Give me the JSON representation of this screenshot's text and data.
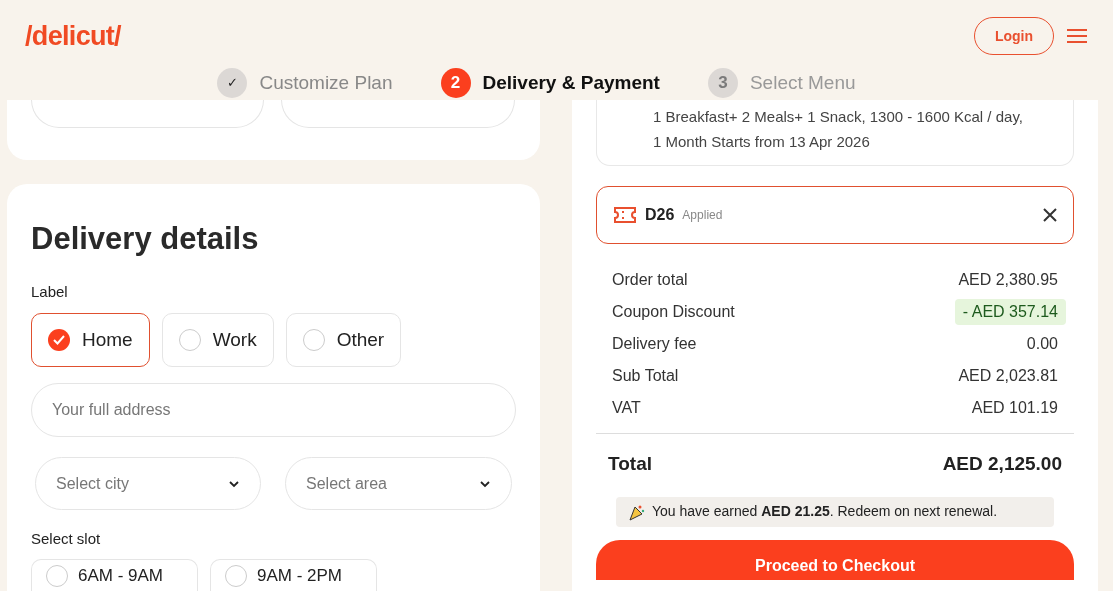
{
  "header": {
    "logo": "/delicut/",
    "login": "Login"
  },
  "steps": [
    {
      "number": "✓",
      "label": "Customize Plan",
      "selected": false,
      "completed": true
    },
    {
      "number": "2",
      "label": "Delivery & Payment",
      "selected": true,
      "completed": false
    },
    {
      "number": "3",
      "label": "Select Menu",
      "selected": false,
      "completed": false
    }
  ],
  "delivery": {
    "title": "Delivery details",
    "label_heading": "Label",
    "labels": [
      {
        "text": "Home",
        "selected": true
      },
      {
        "text": "Work",
        "selected": false
      },
      {
        "text": "Other",
        "selected": false
      }
    ],
    "address": {
      "placeholder": "Your full address"
    },
    "city": {
      "placeholder": "Select city"
    },
    "area": {
      "placeholder": "Select area"
    },
    "slot_heading": "Select slot",
    "slots": [
      {
        "text": "6AM - 9AM",
        "selected": false
      },
      {
        "text": "9AM - 2PM",
        "selected": false
      }
    ]
  },
  "plan": {
    "lines": [
      "1 Breakfast+ 2 Meals+ 1 Snack, 1300 - 1600 Kcal / day,",
      "1 Month Starts from 13 Apr 2026"
    ]
  },
  "coupon": {
    "code": "D26",
    "status": "Applied"
  },
  "summary": [
    {
      "label": "Order total",
      "value": "AED 2,380.95",
      "kind": "plain"
    },
    {
      "label": "Coupon Discount",
      "value": "- AED 357.14",
      "kind": "discount"
    },
    {
      "label": "Delivery fee",
      "value": "0.00",
      "kind": "plain"
    },
    {
      "label": "Sub Total",
      "value": "AED 2,023.81",
      "kind": "plain"
    },
    {
      "label": "VAT",
      "value": "AED 101.19",
      "kind": "plain"
    }
  ],
  "total": {
    "label": "Total",
    "value": "AED 2,125.00"
  },
  "reward": "You have earned **AED 21.25**. Redeem on next renewal.",
  "checkout": "Proceed to Checkout"
}
